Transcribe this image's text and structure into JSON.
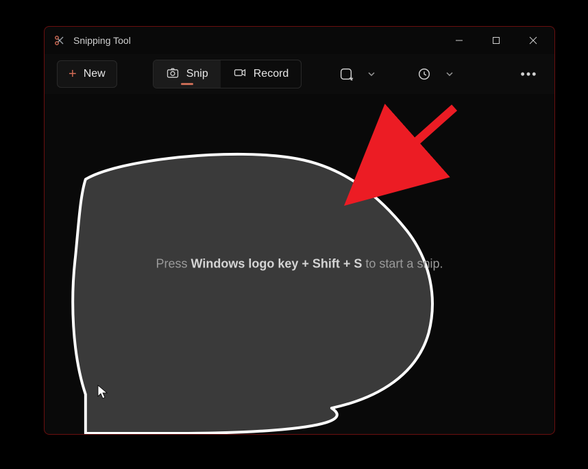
{
  "window": {
    "title": "Snipping Tool"
  },
  "toolbar": {
    "new_label": "New",
    "snip_label": "Snip",
    "record_label": "Record"
  },
  "hint": {
    "prefix": "Press ",
    "combo": "Windows logo key + Shift + S",
    "suffix": " to start a snip."
  },
  "colors": {
    "accent": "#c86b55",
    "annotation_red": "#ec1c24",
    "window_border": "#6b0f0f"
  }
}
